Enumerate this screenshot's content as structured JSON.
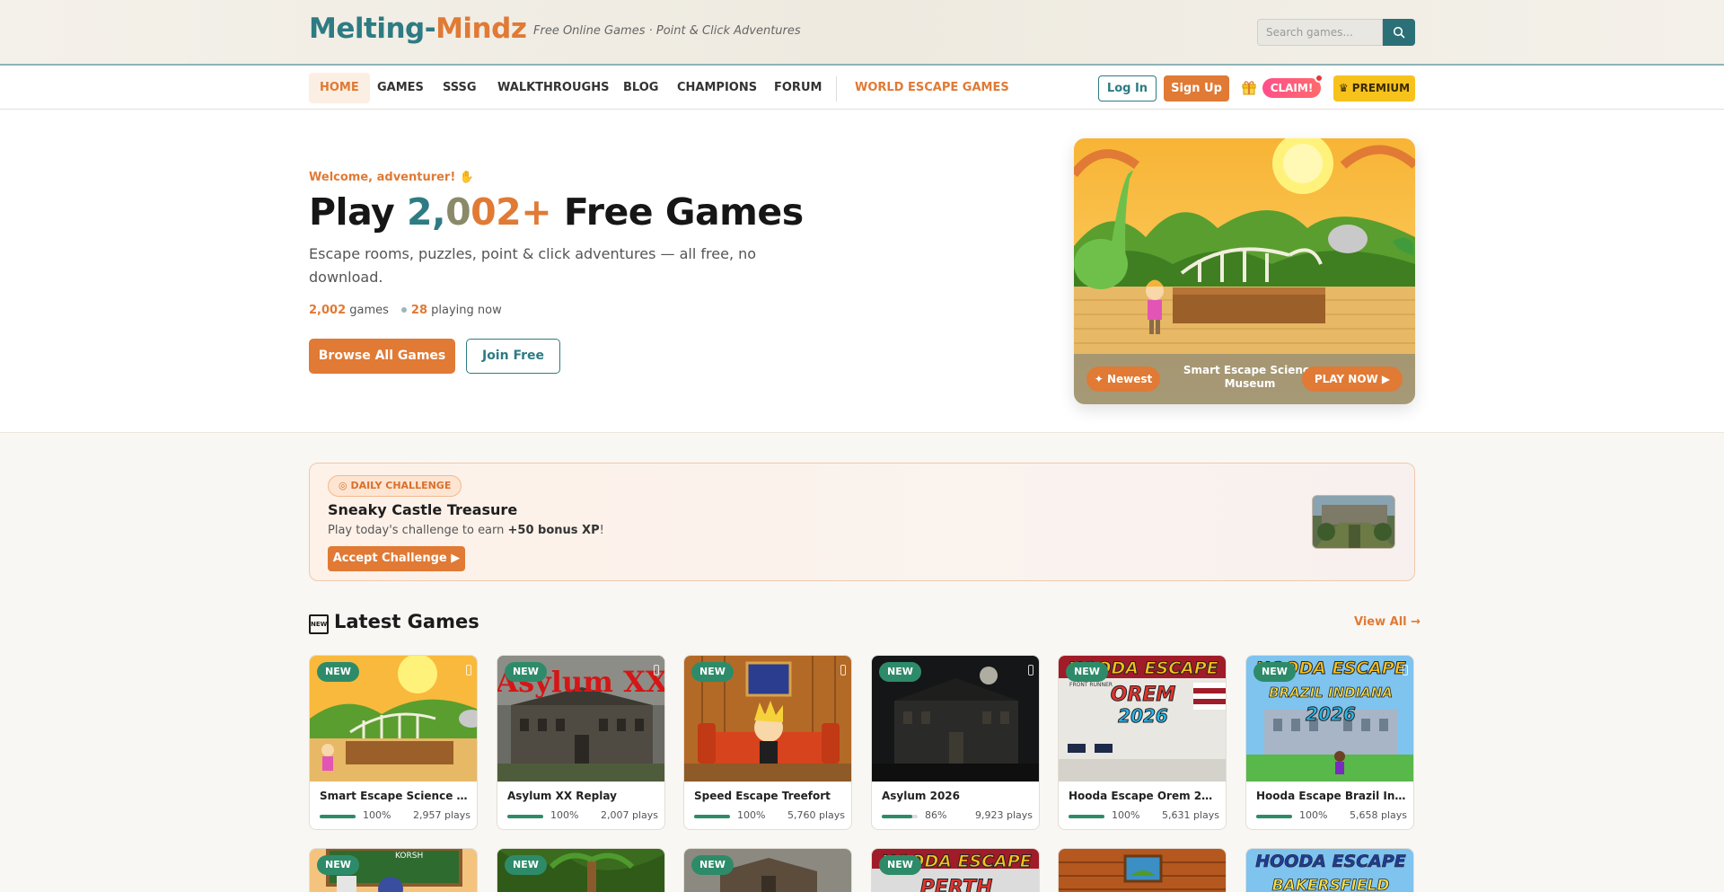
{
  "header": {
    "logo_part1": "Melting-",
    "logo_part2": "Mindz",
    "tagline": "Free Online Games · Point & Click Adventures",
    "search_placeholder": "Search games..."
  },
  "nav": {
    "items": [
      "HOME",
      "GAMES",
      "SSSG",
      "WALKTHROUGHS",
      "BLOG",
      "CHAMPIONS",
      "FORUM"
    ],
    "world": "WORLD ESCAPE GAMES",
    "login": "Log In",
    "signup": "Sign Up",
    "claim": "CLAIM!",
    "premium": "PREMIUM"
  },
  "hero": {
    "welcome": "Welcome, adventurer!",
    "title_pre": "Play ",
    "title_num_d1": "2,",
    "title_num_d2": "0",
    "title_num_rest": "02+",
    "title_post": " Free Games",
    "subtitle": "Escape rooms, puzzles, point & click adventures — all free, no download.",
    "games_count": "2,002",
    "games_label": " games",
    "playing_count": "28",
    "playing_label": " playing now",
    "browse": "Browse All Games",
    "join": "Join Free",
    "card_badge": "Newest",
    "card_game": "Smart Escape Science Museum",
    "card_play": "PLAY NOW ▶"
  },
  "challenge": {
    "tag": "DAILY CHALLENGE",
    "title": "Sneaky Castle Treasure",
    "text_pre": "Play today's challenge to earn ",
    "text_bold": "+50 bonus XP",
    "text_post": "!",
    "button": "Accept Challenge ▶"
  },
  "latest": {
    "title": "Latest Games",
    "emoji_text": "NEW",
    "view_all": "View All →",
    "badge": "NEW",
    "games": [
      {
        "name": "Smart Escape Science Mu...",
        "pct": "100%",
        "rating": 1.0,
        "plays": "2,957 plays"
      },
      {
        "name": "Asylum XX Replay",
        "pct": "100%",
        "rating": 1.0,
        "plays": "2,007 plays"
      },
      {
        "name": "Speed Escape Treefort",
        "pct": "100%",
        "rating": 1.0,
        "plays": "5,760 plays"
      },
      {
        "name": "Asylum 2026",
        "pct": "86%",
        "rating": 0.86,
        "plays": "9,923 plays"
      },
      {
        "name": "Hooda Escape Orem 2026",
        "pct": "100%",
        "rating": 1.0,
        "plays": "5,631 plays"
      },
      {
        "name": "Hooda Escape Brazil India...",
        "pct": "100%",
        "rating": 1.0,
        "plays": "5,658 plays"
      }
    ],
    "thumb_text": {
      "asylum_xx": "Asylum XX",
      "hooda": "HOODA ESCAPE",
      "orem": "OREM",
      "year": "2026",
      "brazil": "BRAZIL INDIANA",
      "front_runner": "FRONT RUNNER",
      "perth": "PERTH",
      "bakersfield": "BAKERSFIELD",
      "korsh": "KORSH"
    }
  },
  "colors": {
    "brand_teal": "#2e7b83",
    "brand_orange": "#e07a35",
    "new_green": "#2e8b6a",
    "premium_yellow": "#f7c21c"
  }
}
